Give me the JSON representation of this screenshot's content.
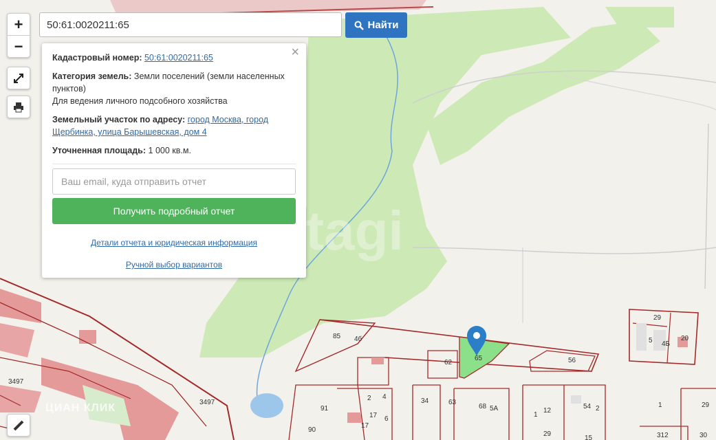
{
  "search": {
    "value": "50:61:0020211:65",
    "button_label": "Найти"
  },
  "controls": {
    "zoom_in": "+",
    "zoom_out": "−"
  },
  "popup": {
    "close_label": "×",
    "cadastral_label": "Кадастровый номер:",
    "cadastral_value": "50:61:0020211:65",
    "category_label": "Категория земель:",
    "category_value": "Земли поселений (земли населенных пунктов)",
    "use_value": "Для ведения личного подсобного хозяйства",
    "address_label": "Земельный участок по адресу:",
    "address_value": "город Москва, город Щербинка, улица Барышевская, дом 4",
    "area_label": "Уточненная площадь:",
    "area_value": "1 000 кв.м.",
    "email_placeholder": "Ваш email, куда отправить отчет",
    "report_button": "Получить подробный отчет",
    "details_link": "Детали отчета и юридическая информация",
    "manual_link": "Ручной выбор вариантов"
  },
  "map": {
    "watermark": "etagi",
    "attribution": "ЦИАН КЛИК",
    "parcel_labels": [
      "29",
      "5",
      "4Б",
      "20",
      "56",
      "65",
      "62",
      "85",
      "4б",
      "2",
      "4",
      "91",
      "17",
      "6",
      "3497",
      "3497",
      "34",
      "63",
      "68",
      "5А",
      "12",
      "54",
      "2",
      "1",
      "29",
      "1",
      "312",
      "30",
      "90",
      "29",
      "15",
      "17"
    ],
    "colors": {
      "forest": "#cde9b6",
      "boundary": "#a32a2a",
      "selected_parcel": "#8de08a",
      "marker": "#2a7fc7",
      "building": "#e59a9a",
      "water": "#9cc6ea"
    }
  }
}
